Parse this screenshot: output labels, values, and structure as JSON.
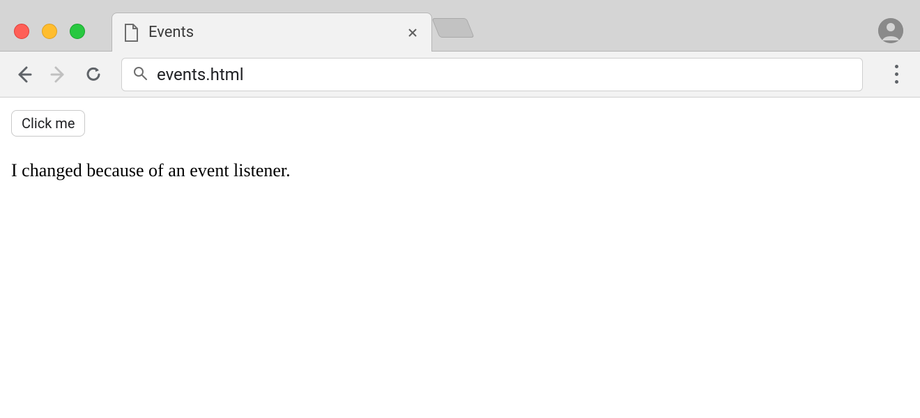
{
  "browser": {
    "tab_title": "Events",
    "address": "events.html"
  },
  "page": {
    "button_label": "Click me",
    "paragraph": "I changed because of an event listener."
  }
}
